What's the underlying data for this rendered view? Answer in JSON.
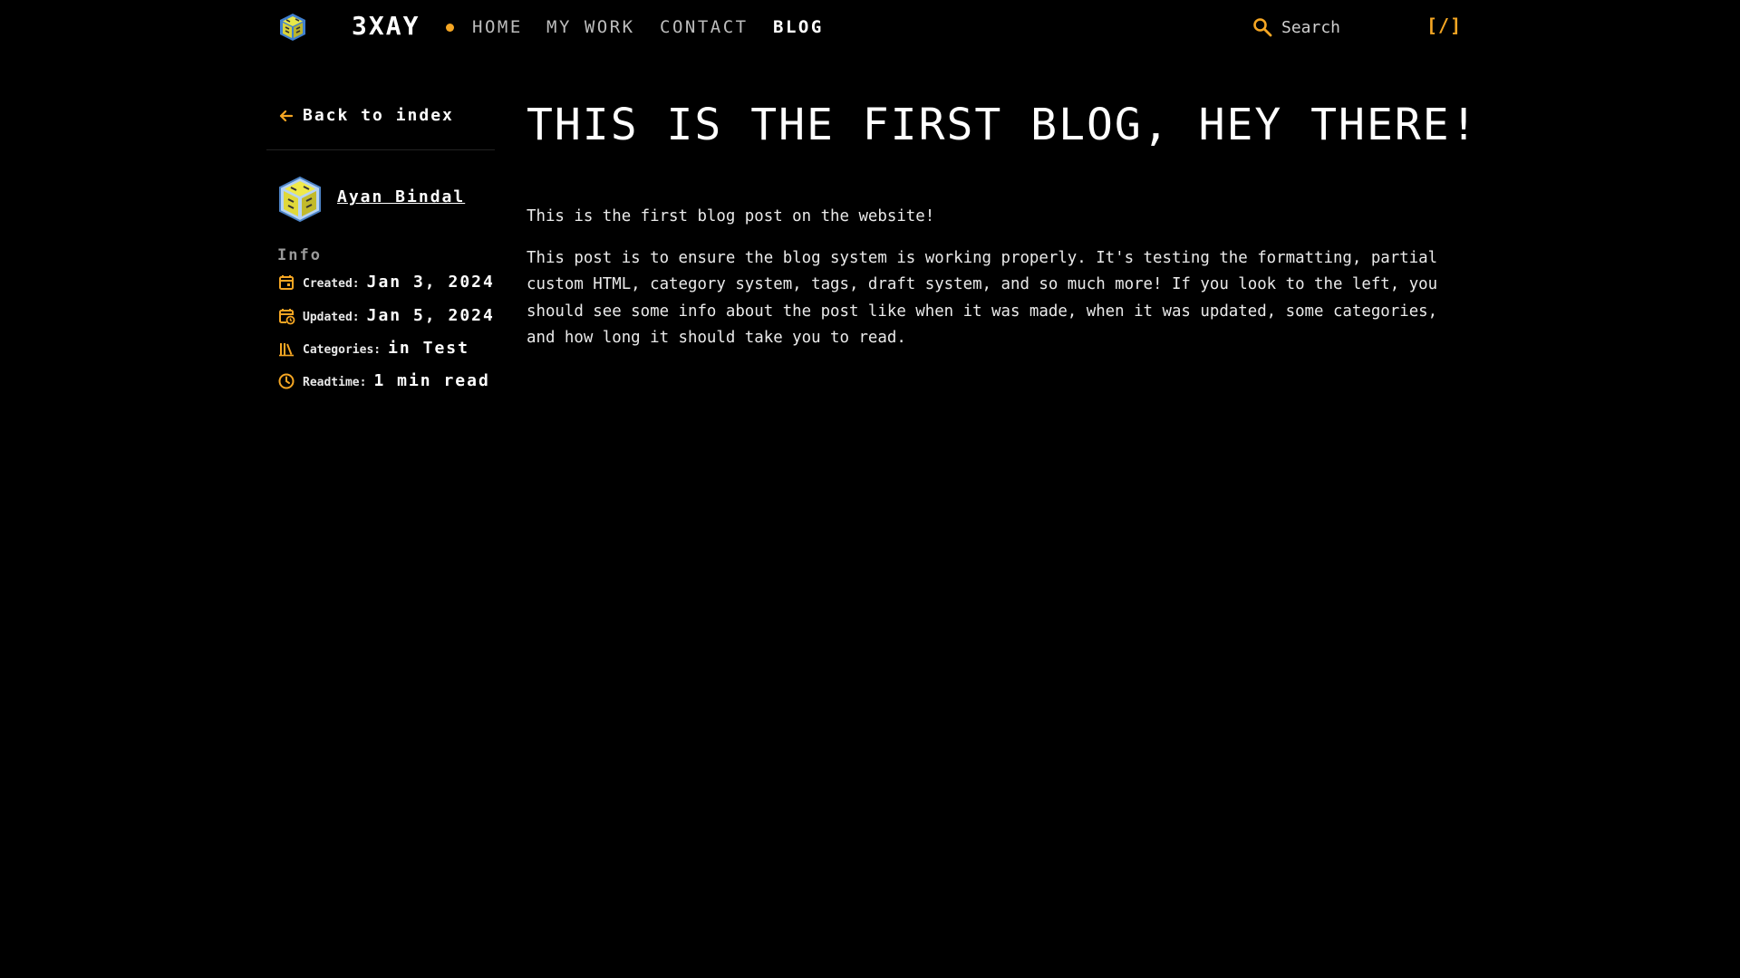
{
  "nav": {
    "brand": "3XAY",
    "links": [
      "HOME",
      "MY WORK",
      "CONTACT",
      "BLOG"
    ],
    "active": "BLOG",
    "search_placeholder": "Search",
    "search_shortcut": "[/]",
    "accent_color": "#f5a623"
  },
  "sidebar": {
    "back_label": "Back to index",
    "author_name": "Ayan Bindal",
    "info_heading": "Info",
    "meta": {
      "created_label": "Created:",
      "created_value": "Jan 3, 2024",
      "updated_label": "Updated:",
      "updated_value": "Jan 5, 2024",
      "categories_label": "Categories:",
      "categories_value": "in Test",
      "readtime_label": "Readtime:",
      "readtime_value": "1 min read"
    }
  },
  "post": {
    "title": "THIS IS THE FIRST BLOG, HEY THERE!",
    "paragraphs": [
      "This is the first blog post on the website!",
      "This post is to ensure the blog system is working properly. It's testing the formatting, partial custom HTML, category system, tags, draft system, and so much more! If you look to the left, you should see some info about the post like when it was made, when it was updated, some categories, and how long it should take you to read."
    ]
  }
}
